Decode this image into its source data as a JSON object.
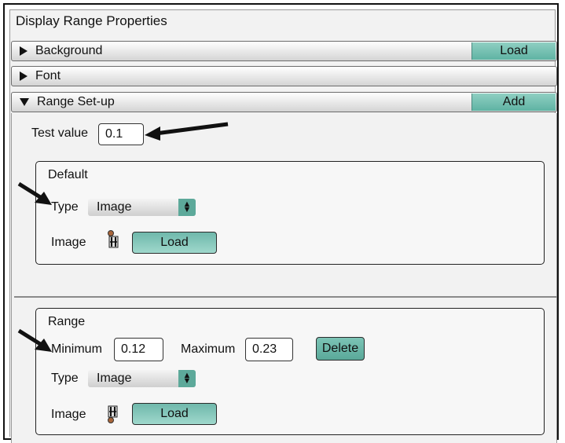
{
  "panel": {
    "title": "Display Range Properties"
  },
  "sections": {
    "background": {
      "label": "Background",
      "button": "Load"
    },
    "font": {
      "label": "Font"
    },
    "range_setup": {
      "label": "Range Set-up",
      "button": "Add"
    }
  },
  "test_value": {
    "label": "Test value",
    "value": "0.1"
  },
  "default_box": {
    "title": "Default",
    "type_label": "Type",
    "type_value": "Image",
    "image_label": "Image",
    "load_label": "Load"
  },
  "range_box": {
    "title": "Range",
    "min_label": "Minimum",
    "min_value": "0.12",
    "max_label": "Maximum",
    "max_value": "0.23",
    "delete_label": "Delete",
    "type_label": "Type",
    "type_value": "Image",
    "image_label": "Image",
    "load_label": "Load"
  },
  "icons": {
    "triangle_collapsed": "triangle-right-icon",
    "triangle_expanded": "triangle-down-icon",
    "select_arrows": "up-down-arrows-icon",
    "image_preview": "image-thumbnail-icon",
    "annotation_arrow": "annotation-arrow-icon"
  },
  "colors": {
    "accent": "#6cb8aa",
    "border": "#222222"
  }
}
